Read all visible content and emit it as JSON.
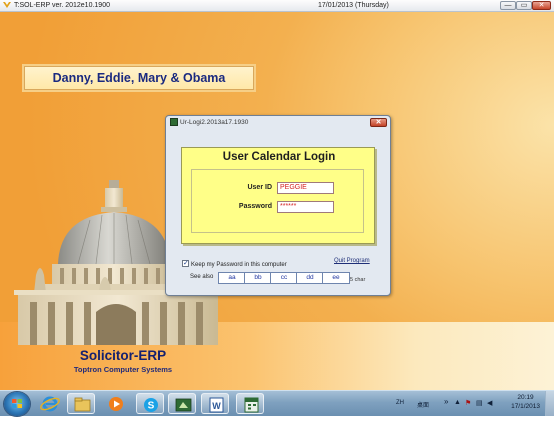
{
  "window": {
    "title": "T:SOL-ERP ver. 2012e10.1900",
    "date_center": "17/01/2013  (Thursday)",
    "controls": {
      "minimize": "—",
      "maximize": "▭",
      "close": "✕"
    }
  },
  "desktop": {
    "banner": "Danny, Eddie, Mary & Obama",
    "brand_name": "Solicitor-ERP",
    "brand_sub": "Toptron Computer Systems"
  },
  "dialog": {
    "title": "Ur-Logi2.2013a17.1930",
    "close_label": "✕",
    "heading": "User Calendar Login",
    "user_id_label": "User ID",
    "user_id_value": "PEGGIE",
    "password_label": "Password",
    "password_value": "******",
    "keep_password_label": "Keep my Password in this computer",
    "keep_password_checked": true,
    "quit_label": "Quit Program",
    "see_also_label": "See also",
    "see_also_buttons": [
      "aa",
      "bb",
      "cc",
      "dd",
      "ee"
    ],
    "char_note": "5 char"
  },
  "taskbar": {
    "tray_lang": "ZH",
    "tray_text": "桌面",
    "tray_chevron": "»",
    "clock_time": "20:19",
    "clock_date": "17/1/2013",
    "apps": [
      "internet-explorer",
      "file-explorer",
      "media-player",
      "skype",
      "erp-app",
      "word",
      "calendar-app"
    ]
  },
  "colors": {
    "banner_text": "#1b2a80",
    "panel_yellow": "#ffff88",
    "field_text": "#d42020",
    "see_also_text": "#1f35a0"
  }
}
